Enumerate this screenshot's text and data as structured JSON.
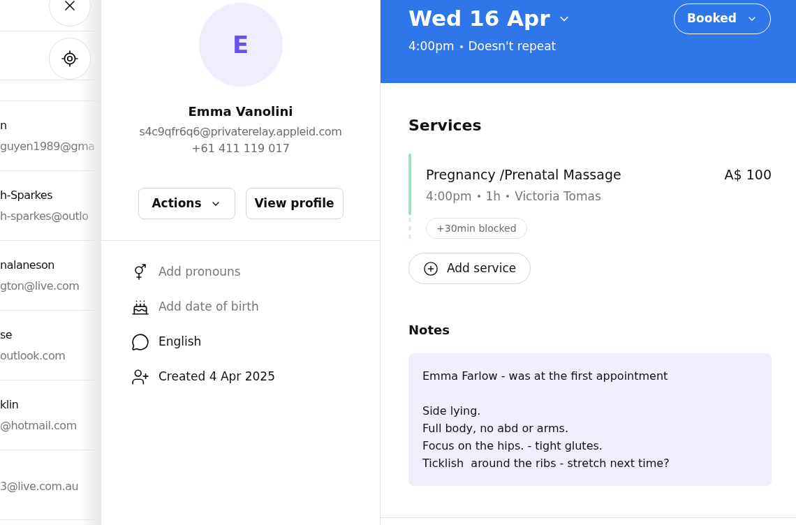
{
  "client_list": [
    {
      "name": "n",
      "email": "guyen1989@gma"
    },
    {
      "name": "h-Sparkes",
      "email": "h-sparkes@outlo"
    },
    {
      "name": "nalaneson",
      "email": "gton@live.com"
    },
    {
      "name": "se",
      "email": "outlook.com"
    },
    {
      "name": "klin",
      "email": "@hotmail.com"
    },
    {
      "email": "3@live.com.au"
    }
  ],
  "client": {
    "initial": "E",
    "name": "Emma Vanolini",
    "email": "s4c9qfr6q6@privaterelay.appleid.com",
    "phone": "+61 411 119 017",
    "actions": "Actions",
    "view_profile": "View profile",
    "details": [
      {
        "kind": "placeholder",
        "text": "Add pronouns"
      },
      {
        "kind": "placeholder",
        "text": "Add date of birth"
      },
      {
        "kind": "value",
        "text": "English"
      },
      {
        "kind": "value",
        "text": "Created 4 Apr 2025"
      }
    ]
  },
  "appointment": {
    "date": "Wed 16 Apr",
    "time": "4:00pm",
    "repeat": "Doesn't repeat",
    "status": "Booked",
    "services_title": "Services",
    "services": [
      {
        "name": "Pregnancy /Prenatal Massage",
        "price": "A$ 100",
        "time": "4:00pm",
        "duration": "1h",
        "staff": "Victoria Tomas",
        "blocked": "+30min blocked"
      }
    ],
    "add_service": "Add service",
    "notes_title": "Notes",
    "notes": [
      [
        "Emma Farlow - was at the first appointment"
      ],
      [
        "Side lying.",
        "Full body, no abd or arms.",
        "Focus on the hips. - tight glutes.",
        "Ticklish  around the ribs - stretch next time?"
      ]
    ]
  }
}
